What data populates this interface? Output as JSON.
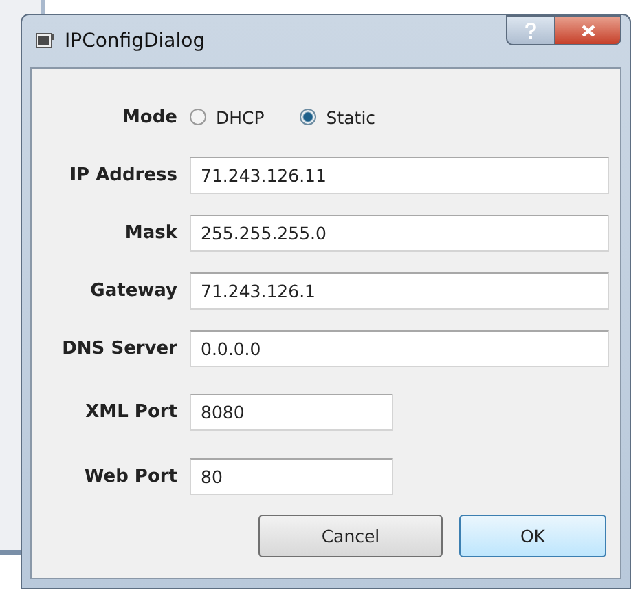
{
  "window": {
    "title": "IPConfigDialog"
  },
  "mode": {
    "label": "Mode",
    "options": [
      {
        "label": "DHCP",
        "selected": false
      },
      {
        "label": "Static",
        "selected": true
      }
    ]
  },
  "fields": [
    {
      "label": "IP Address",
      "value": "71.243.126.11",
      "kind": "wide"
    },
    {
      "label": "Mask",
      "value": "255.255.255.0",
      "kind": "wide"
    },
    {
      "label": "Gateway",
      "value": "71.243.126.1",
      "kind": "wide"
    },
    {
      "label": "DNS Server",
      "value": "0.0.0.0",
      "kind": "wide"
    },
    {
      "label": "XML Port",
      "value": "8080",
      "kind": "short"
    },
    {
      "label": "Web Port",
      "value": "80",
      "kind": "short"
    }
  ],
  "buttons": [
    {
      "label": "Cancel",
      "kind": "normal"
    },
    {
      "label": "OK",
      "kind": "default"
    }
  ]
}
